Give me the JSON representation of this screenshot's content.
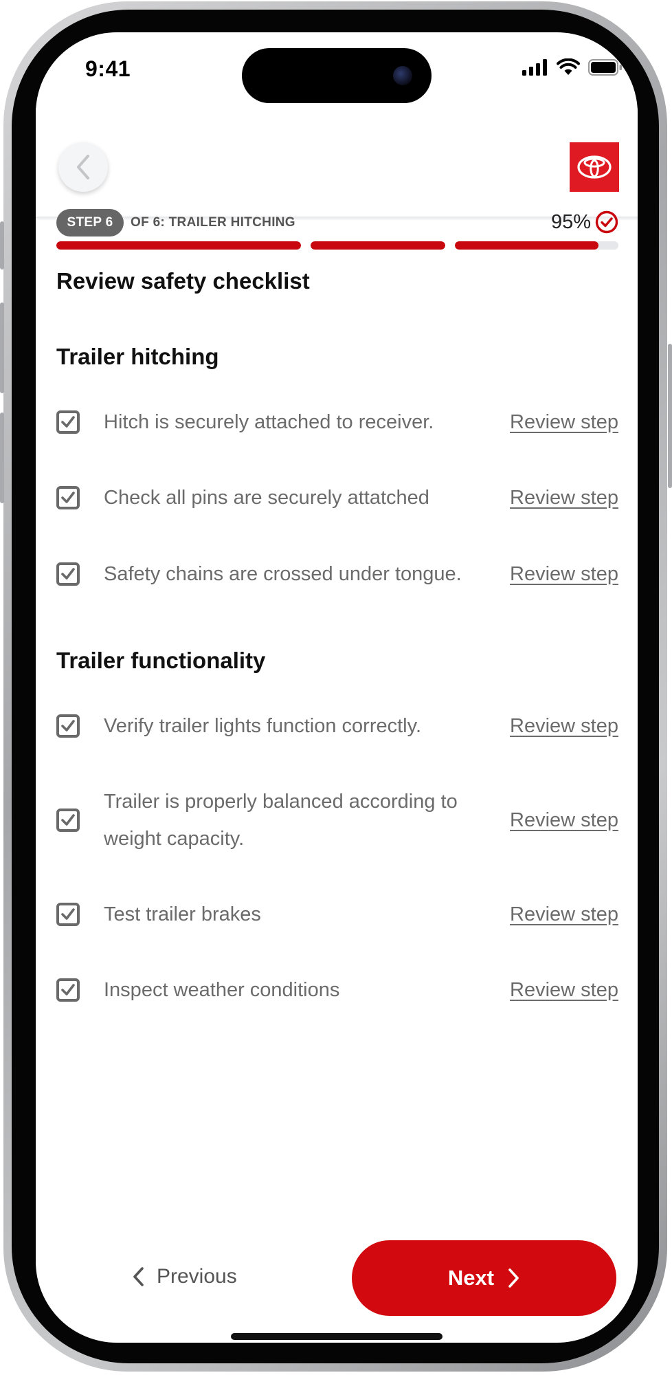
{
  "status_bar": {
    "time": "9:41"
  },
  "header": {
    "back_label": "",
    "logo": "toyota-logo"
  },
  "progress": {
    "step_pill": "STEP 6",
    "step_text": "OF 6: TRAILER HITCHING",
    "percent_text": "95%",
    "segments": [
      1.0,
      1.0,
      0.88
    ]
  },
  "content": {
    "title": "Review safety checklist",
    "sections": [
      {
        "title": "Trailer hitching",
        "items": [
          {
            "text": "Hitch is securely attached to receiver.",
            "link": "Review step",
            "checked": true
          },
          {
            "text": "Check all pins are securely attatched",
            "link": "Review step",
            "checked": true
          },
          {
            "text": "Safety chains are crossed under tongue.",
            "link": "Review step",
            "checked": true
          }
        ]
      },
      {
        "title": "Trailer functionality",
        "items": [
          {
            "text": "Verify trailer lights function correctly.",
            "link": "Review step",
            "checked": true
          },
          {
            "text": "Trailer is properly balanced according to weight capacity.",
            "link": "Review step",
            "checked": true
          },
          {
            "text": "Test trailer brakes",
            "link": "Review step",
            "checked": true
          },
          {
            "text": "Inspect weather conditions",
            "link": "Review step",
            "checked": true
          }
        ]
      }
    ]
  },
  "footer": {
    "previous_label": "Previous",
    "next_label": "Next"
  },
  "colors": {
    "accent": "#d20a0f",
    "logo_red": "#e01a22",
    "text_muted": "#6b6b6b"
  }
}
